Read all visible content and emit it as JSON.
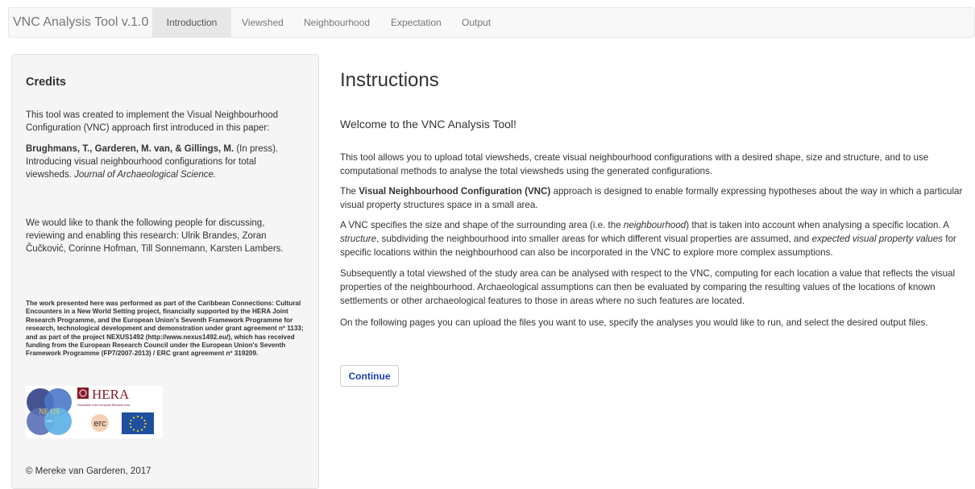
{
  "app": {
    "title": "VNC Analysis Tool v.1.0",
    "tabs": [
      "Introduction",
      "Viewshed",
      "Neighbourhood",
      "Expectation",
      "Output"
    ],
    "active_tab": "Introduction"
  },
  "sidebar": {
    "title": "Credits",
    "p1": "This tool was created to implement the Visual Neighbourhood Configuration (VNC) approach first introduced in this paper:",
    "citation_authors": "Brughmans, T., Garderen, M. van, & Gillings, M.",
    "citation_status": " (In press). Introducing visual neighbourhood configurations for total viewsheds. ",
    "citation_journal": "Journal of Archaeological Science.",
    "thanks": "We would like to thank the following people for discussing, reviewing and enabling this research: Ulrik Brandes, Zoran Čučković, Corinne Hofman, Till Sonnemann, Karsten Lambers.",
    "funding": "The work presented here was performed as part of the Caribbean Connections: Cultural Encounters in a New World Setting project, financially supported by the HERA Joint Research Programme, and the European Union's Seventh Framework Programme for research, technological development and demonstration under grant agreement nº 1133; and as part of the project NEXUS1492 (http://www.nexus1492.eu/), which has received funding from the European Research Council under the European Union's Seventh Framework Programme (FP7/2007-2013) / ERC grant agreement nº 319209.",
    "logos": {
      "nexus": "NE US",
      "nexus_sub": "1492",
      "hera": "HERA",
      "hera_sub": "Humanities in the European Research Area",
      "erc": "erc"
    },
    "copyright": "© Mereke van Garderen, 2017"
  },
  "main": {
    "title": "Instructions",
    "welcome": "Welcome to the VNC Analysis Tool!",
    "p1": "This tool allows you to upload total viewsheds, create visual neighbourhood configurations with a desired shape, size and structure, and to use computational methods to analyse the total viewsheds using the generated configurations.",
    "p2_lead": "The ",
    "p2_bold": "Visual Neighbourhood Configuration (VNC)",
    "p2_rest": " approach is designed to enable formally expressing hypotheses about the way in which a particular visual property structures space in a small area.",
    "p3_a": "A VNC specifies the size and shape of the surrounding area (i.e. the ",
    "p3_i1": "neighbourhood",
    "p3_b": ") that is taken into account when analysing a specific location. A ",
    "p3_i2": "structure",
    "p3_c": ", subdividing the neighbourhood into smaller areas for which different visual properties are assumed, and ",
    "p3_i3": "expected visual property values",
    "p3_d": " for specific locations within the neighbourhood can also be incorporated in the VNC to explore more complex assumptions.",
    "p4": "Subsequently a total viewshed of the study area can be analysed with respect to the VNC, computing for each location a value that reflects the visual properties of the neighbourhood. Archaeological assumptions can then be evaluated by comparing the resulting values of the locations of known settlements or other archaeological features to those in areas where no such features are located.",
    "p5": "On the following pages you can upload the files you want to use, specify the analyses you would like to run, and select the desired output files.",
    "continue_label": "Continue"
  }
}
